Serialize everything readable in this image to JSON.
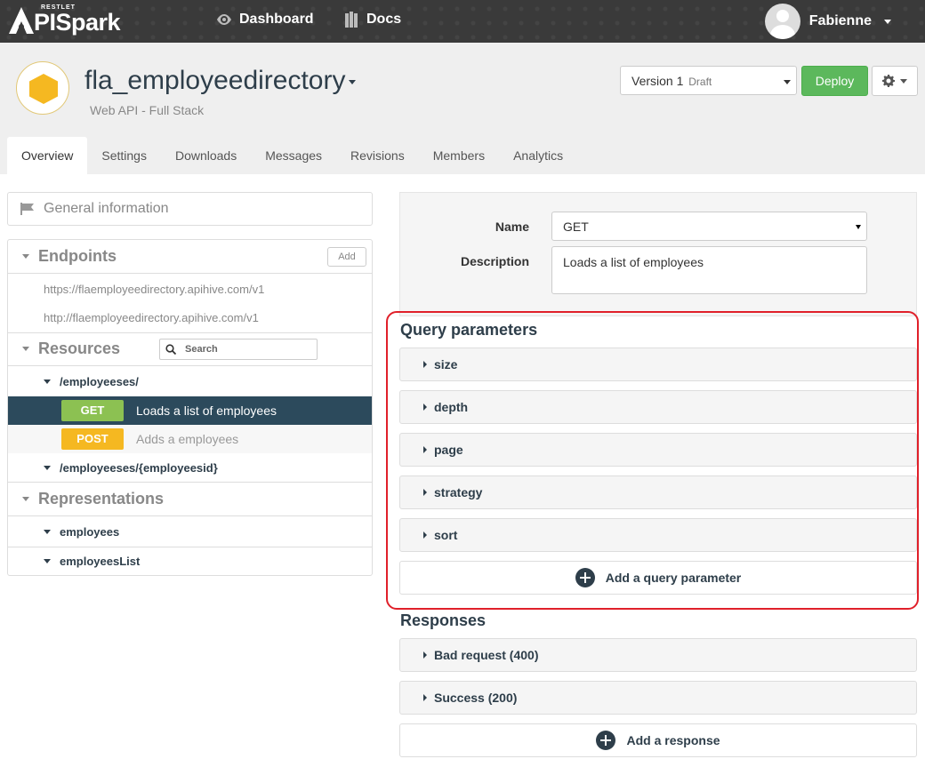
{
  "topbar": {
    "logo_restlet": "RESTLET",
    "logo_text": "PISpark",
    "dashboard_label": "Dashboard",
    "docs_label": "Docs",
    "user_name": "Fabienne"
  },
  "header": {
    "api_title": "fla_employeedirectory",
    "api_subtitle": "Web API - Full Stack",
    "version_label": "Version 1",
    "version_status": "Draft",
    "deploy_label": "Deploy",
    "accent_color": "#f5b821",
    "deploy_color": "#5cb85c"
  },
  "tabs": [
    {
      "label": "Overview",
      "active": true
    },
    {
      "label": "Settings"
    },
    {
      "label": "Downloads"
    },
    {
      "label": "Messages"
    },
    {
      "label": "Revisions"
    },
    {
      "label": "Members"
    },
    {
      "label": "Analytics"
    }
  ],
  "left": {
    "general_info": "General information",
    "endpoints_title": "Endpoints",
    "endpoints_add": "Add",
    "endpoints": [
      "https://flaemployeedirectory.apihive.com/v1",
      "http://flaemployeedirectory.apihive.com/v1"
    ],
    "resources_title": "Resources",
    "search_placeholder": "Search",
    "resources": [
      {
        "path": "/employeeses/"
      },
      {
        "path": "/employeeses/{employeesid}"
      }
    ],
    "methods": [
      {
        "method": "GET",
        "description": "Loads a list of employees",
        "color": "#8cc152"
      },
      {
        "method": "POST",
        "description": "Adds a employees",
        "color": "#f5b821"
      }
    ],
    "representations_title": "Representations",
    "representations": [
      "employees",
      "employeesList"
    ]
  },
  "right": {
    "name_label": "Name",
    "name_value": "GET",
    "description_label": "Description",
    "description_value": "Loads a list of employees",
    "query_title": "Query parameters",
    "query_params": [
      "size",
      "depth",
      "page",
      "strategy",
      "sort"
    ],
    "add_query_label": "Add a query parameter",
    "responses_title": "Responses",
    "responses": [
      "Bad request (400)",
      "Success (200)"
    ],
    "add_response_label": "Add a response"
  }
}
